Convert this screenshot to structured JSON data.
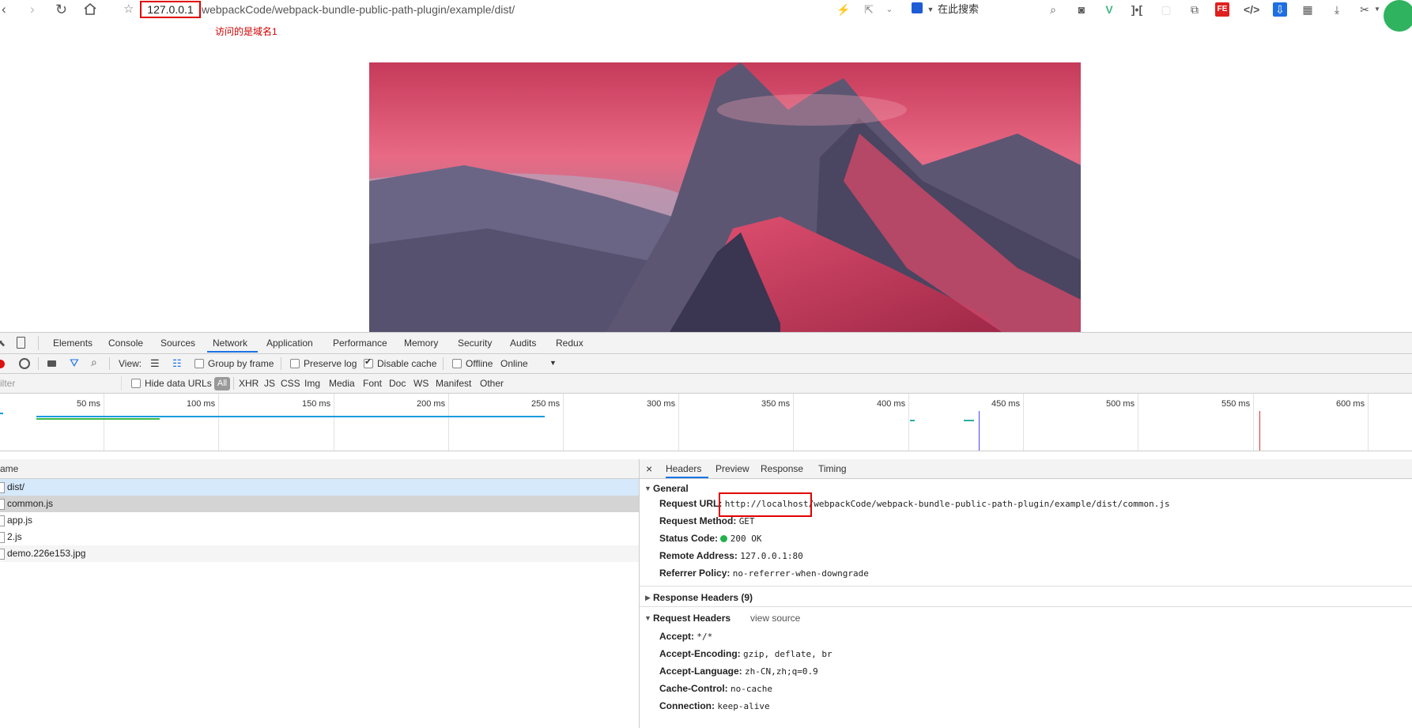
{
  "browser": {
    "url_host": "127.0.0.1",
    "url_path": "webpackCode/webpack-bundle-public-path-plugin/example/dist/",
    "search_placeholder": "在此搜索",
    "annotation": "访问的是域名1"
  },
  "devtools": {
    "tabs": [
      "Elements",
      "Console",
      "Sources",
      "Network",
      "Application",
      "Performance",
      "Memory",
      "Security",
      "Audits",
      "Redux"
    ],
    "active_tab": "Network",
    "toolbar": {
      "view_label": "View:",
      "group_by_frame": "Group by frame",
      "preserve_log": "Preserve log",
      "disable_cache": "Disable cache",
      "offline": "Offline",
      "throttle": "Online"
    },
    "filter": {
      "placeholder": "ilter",
      "hide_data_urls": "Hide data URLs",
      "types": [
        "All",
        "XHR",
        "JS",
        "CSS",
        "Img",
        "Media",
        "Font",
        "Doc",
        "WS",
        "Manifest",
        "Other"
      ]
    },
    "timeline_ticks": [
      "50 ms",
      "100 ms",
      "150 ms",
      "200 ms",
      "250 ms",
      "300 ms",
      "350 ms",
      "400 ms",
      "450 ms",
      "500 ms",
      "550 ms",
      "600 ms"
    ],
    "list_header": "ame",
    "requests": [
      "dist/",
      "common.js",
      "app.js",
      "2.js",
      "demo.226e153.jpg"
    ],
    "details": {
      "close": "×",
      "tabs": [
        "Headers",
        "Preview",
        "Response",
        "Timing"
      ],
      "general_title": "General",
      "request_url_label": "Request URL:",
      "request_url_value": "http://localhost/webpackCode/webpack-bundle-public-path-plugin/example/dist/common.js",
      "request_method_label": "Request Method:",
      "request_method_value": "GET",
      "status_code_label": "Status Code:",
      "status_code_value": "200 OK",
      "remote_address_label": "Remote Address:",
      "remote_address_value": "127.0.0.1:80",
      "referrer_policy_label": "Referrer Policy:",
      "referrer_policy_value": "no-referrer-when-downgrade",
      "response_headers_title": "Response Headers (9)",
      "request_headers_title": "Request Headers",
      "view_source": "view source",
      "accept_label": "Accept:",
      "accept_value": "*/*",
      "accept_encoding_label": "Accept-Encoding:",
      "accept_encoding_value": "gzip, deflate, br",
      "accept_language_label": "Accept-Language:",
      "accept_language_value": "zh-CN,zh;q=0.9",
      "cache_control_label": "Cache-Control:",
      "cache_control_value": "no-cache",
      "connection_label": "Connection:",
      "connection_value": "keep-alive"
    }
  },
  "colors": {
    "annotation_red": "#e00000",
    "accent_blue": "#1a73e8",
    "status_green": "#22b14c"
  }
}
